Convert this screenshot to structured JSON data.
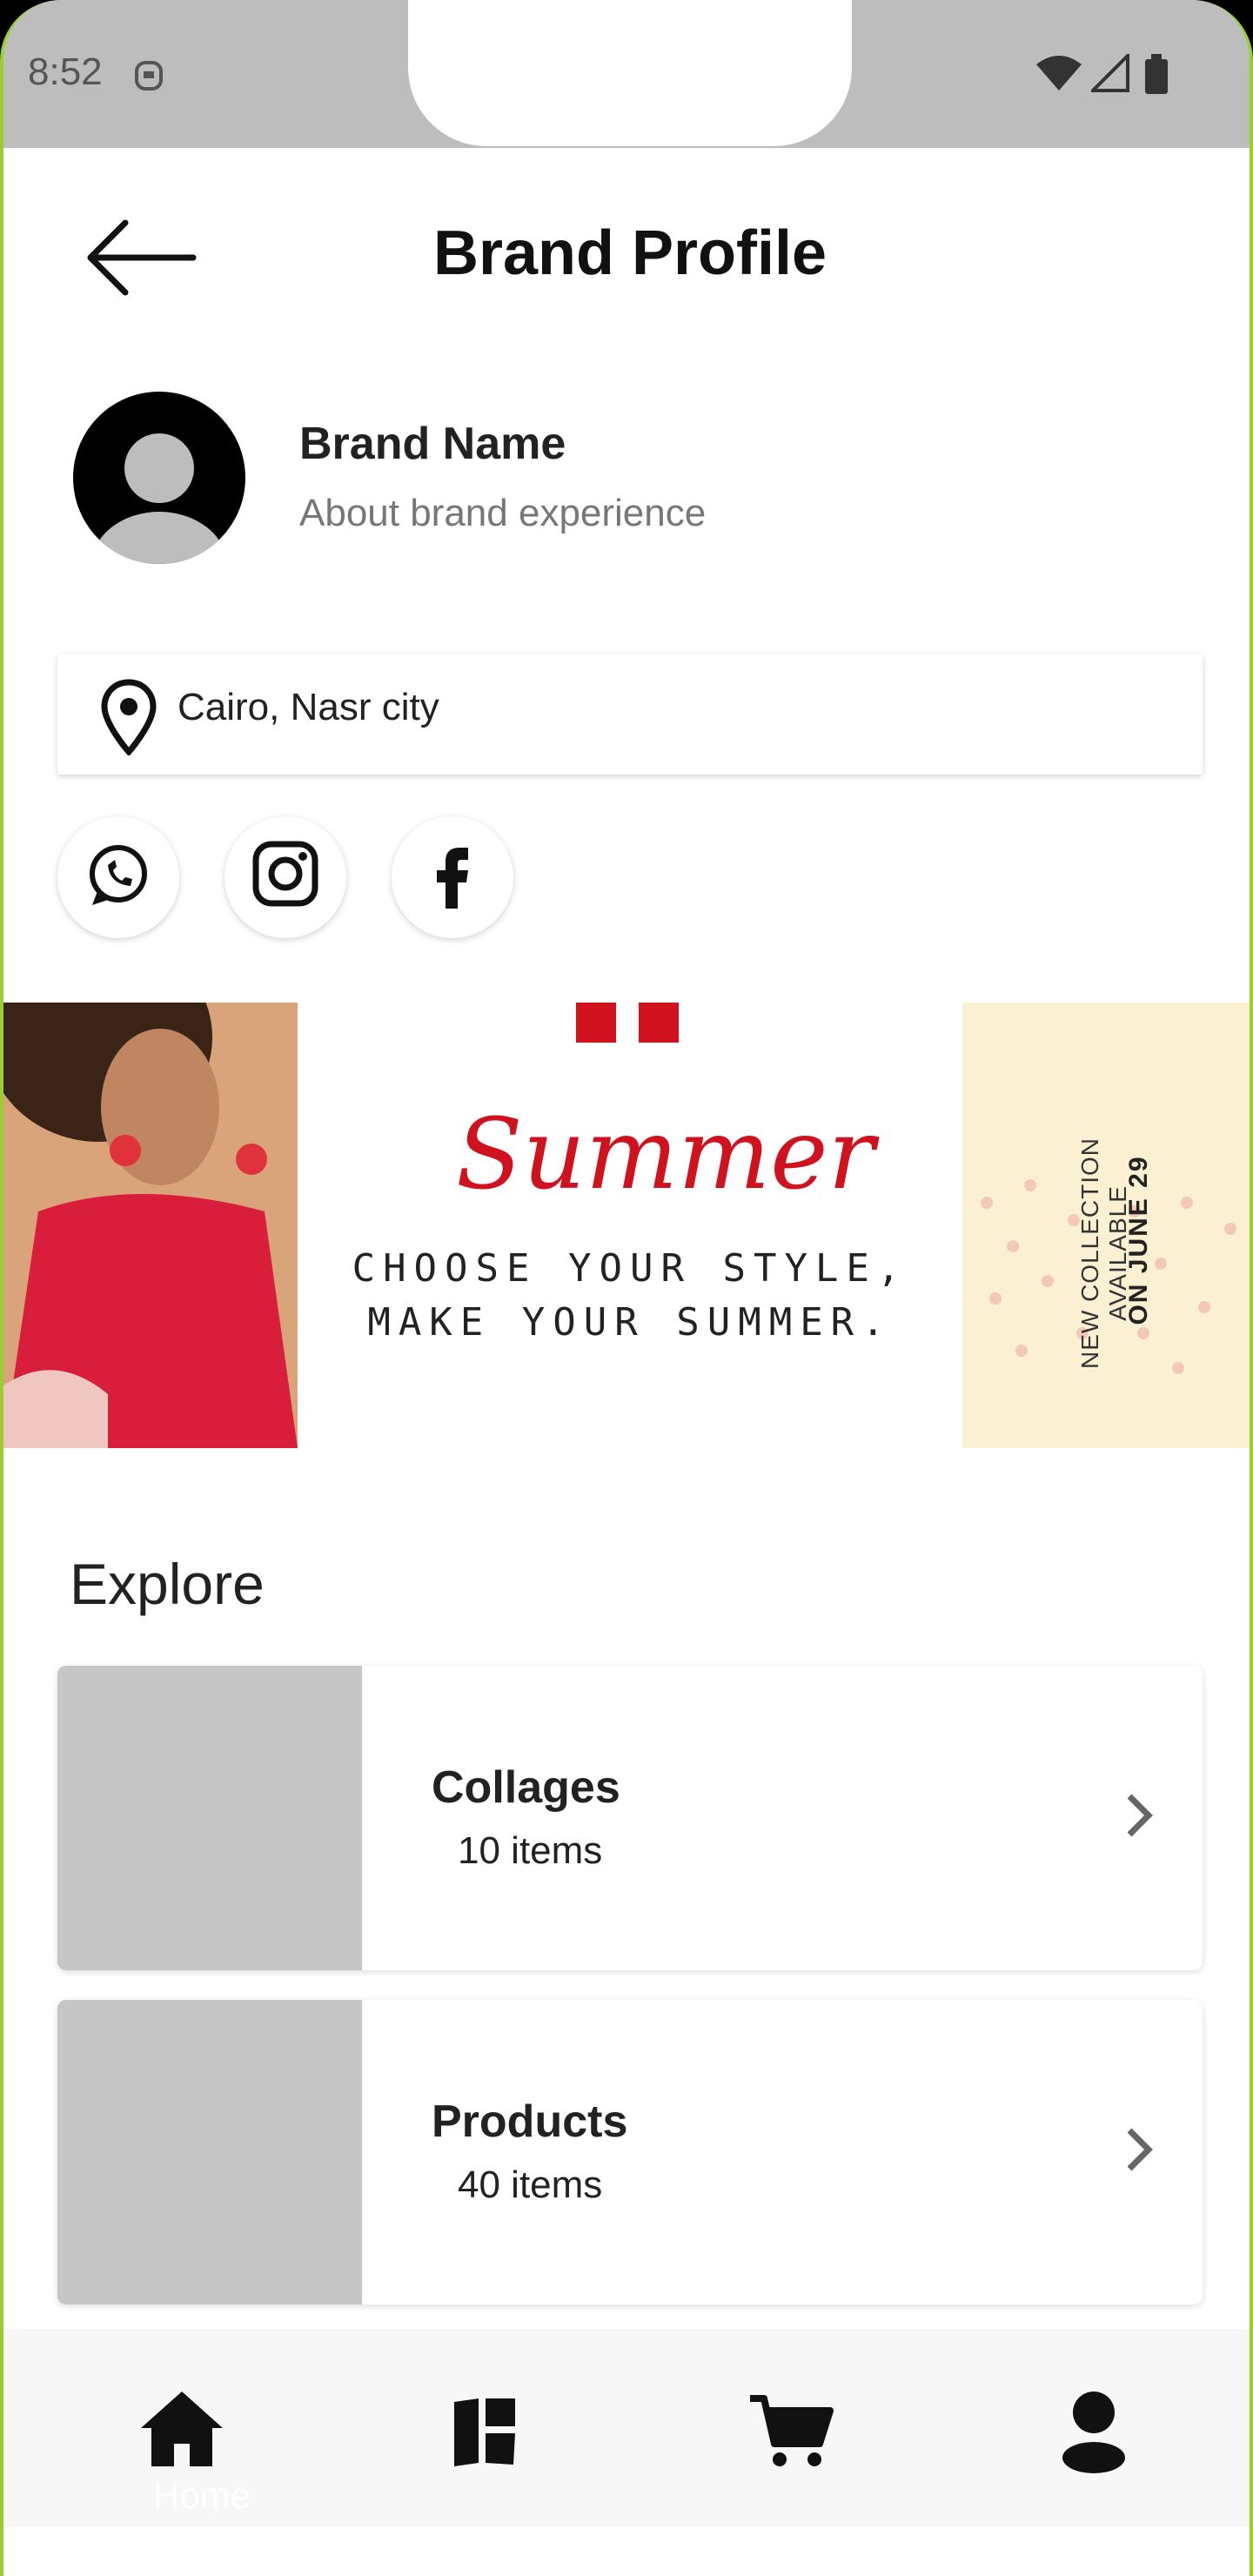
{
  "status_bar": {
    "time": "8:52"
  },
  "header": {
    "title": "Brand Profile",
    "back_icon": "arrow-left-icon"
  },
  "brand": {
    "name": "Brand Name",
    "about": "About brand experience"
  },
  "location": {
    "text": "Cairo, Nasr city",
    "icon": "location-pin-icon"
  },
  "social": [
    {
      "icon": "whatsapp-icon"
    },
    {
      "icon": "instagram-icon"
    },
    {
      "icon": "facebook-icon"
    }
  ],
  "banner": {
    "script_title": "Summer",
    "line1": "CHOOSE YOUR STYLE,",
    "line2": "MAKE YOUR SUMMER.",
    "side_line1": "NEW COLLECTION AVAILABLE",
    "side_line2": "ON JUNE 29",
    "accent": "#d0121f"
  },
  "explore": {
    "heading": "Explore",
    "items": [
      {
        "title": "Collages",
        "count": "10 items"
      },
      {
        "title": "Products",
        "count": "40 items"
      }
    ]
  },
  "bottom_nav": {
    "items": [
      {
        "icon": "home-icon",
        "label": "Home"
      },
      {
        "icon": "collages-icon"
      },
      {
        "icon": "cart-icon"
      },
      {
        "icon": "profile-icon"
      }
    ]
  }
}
